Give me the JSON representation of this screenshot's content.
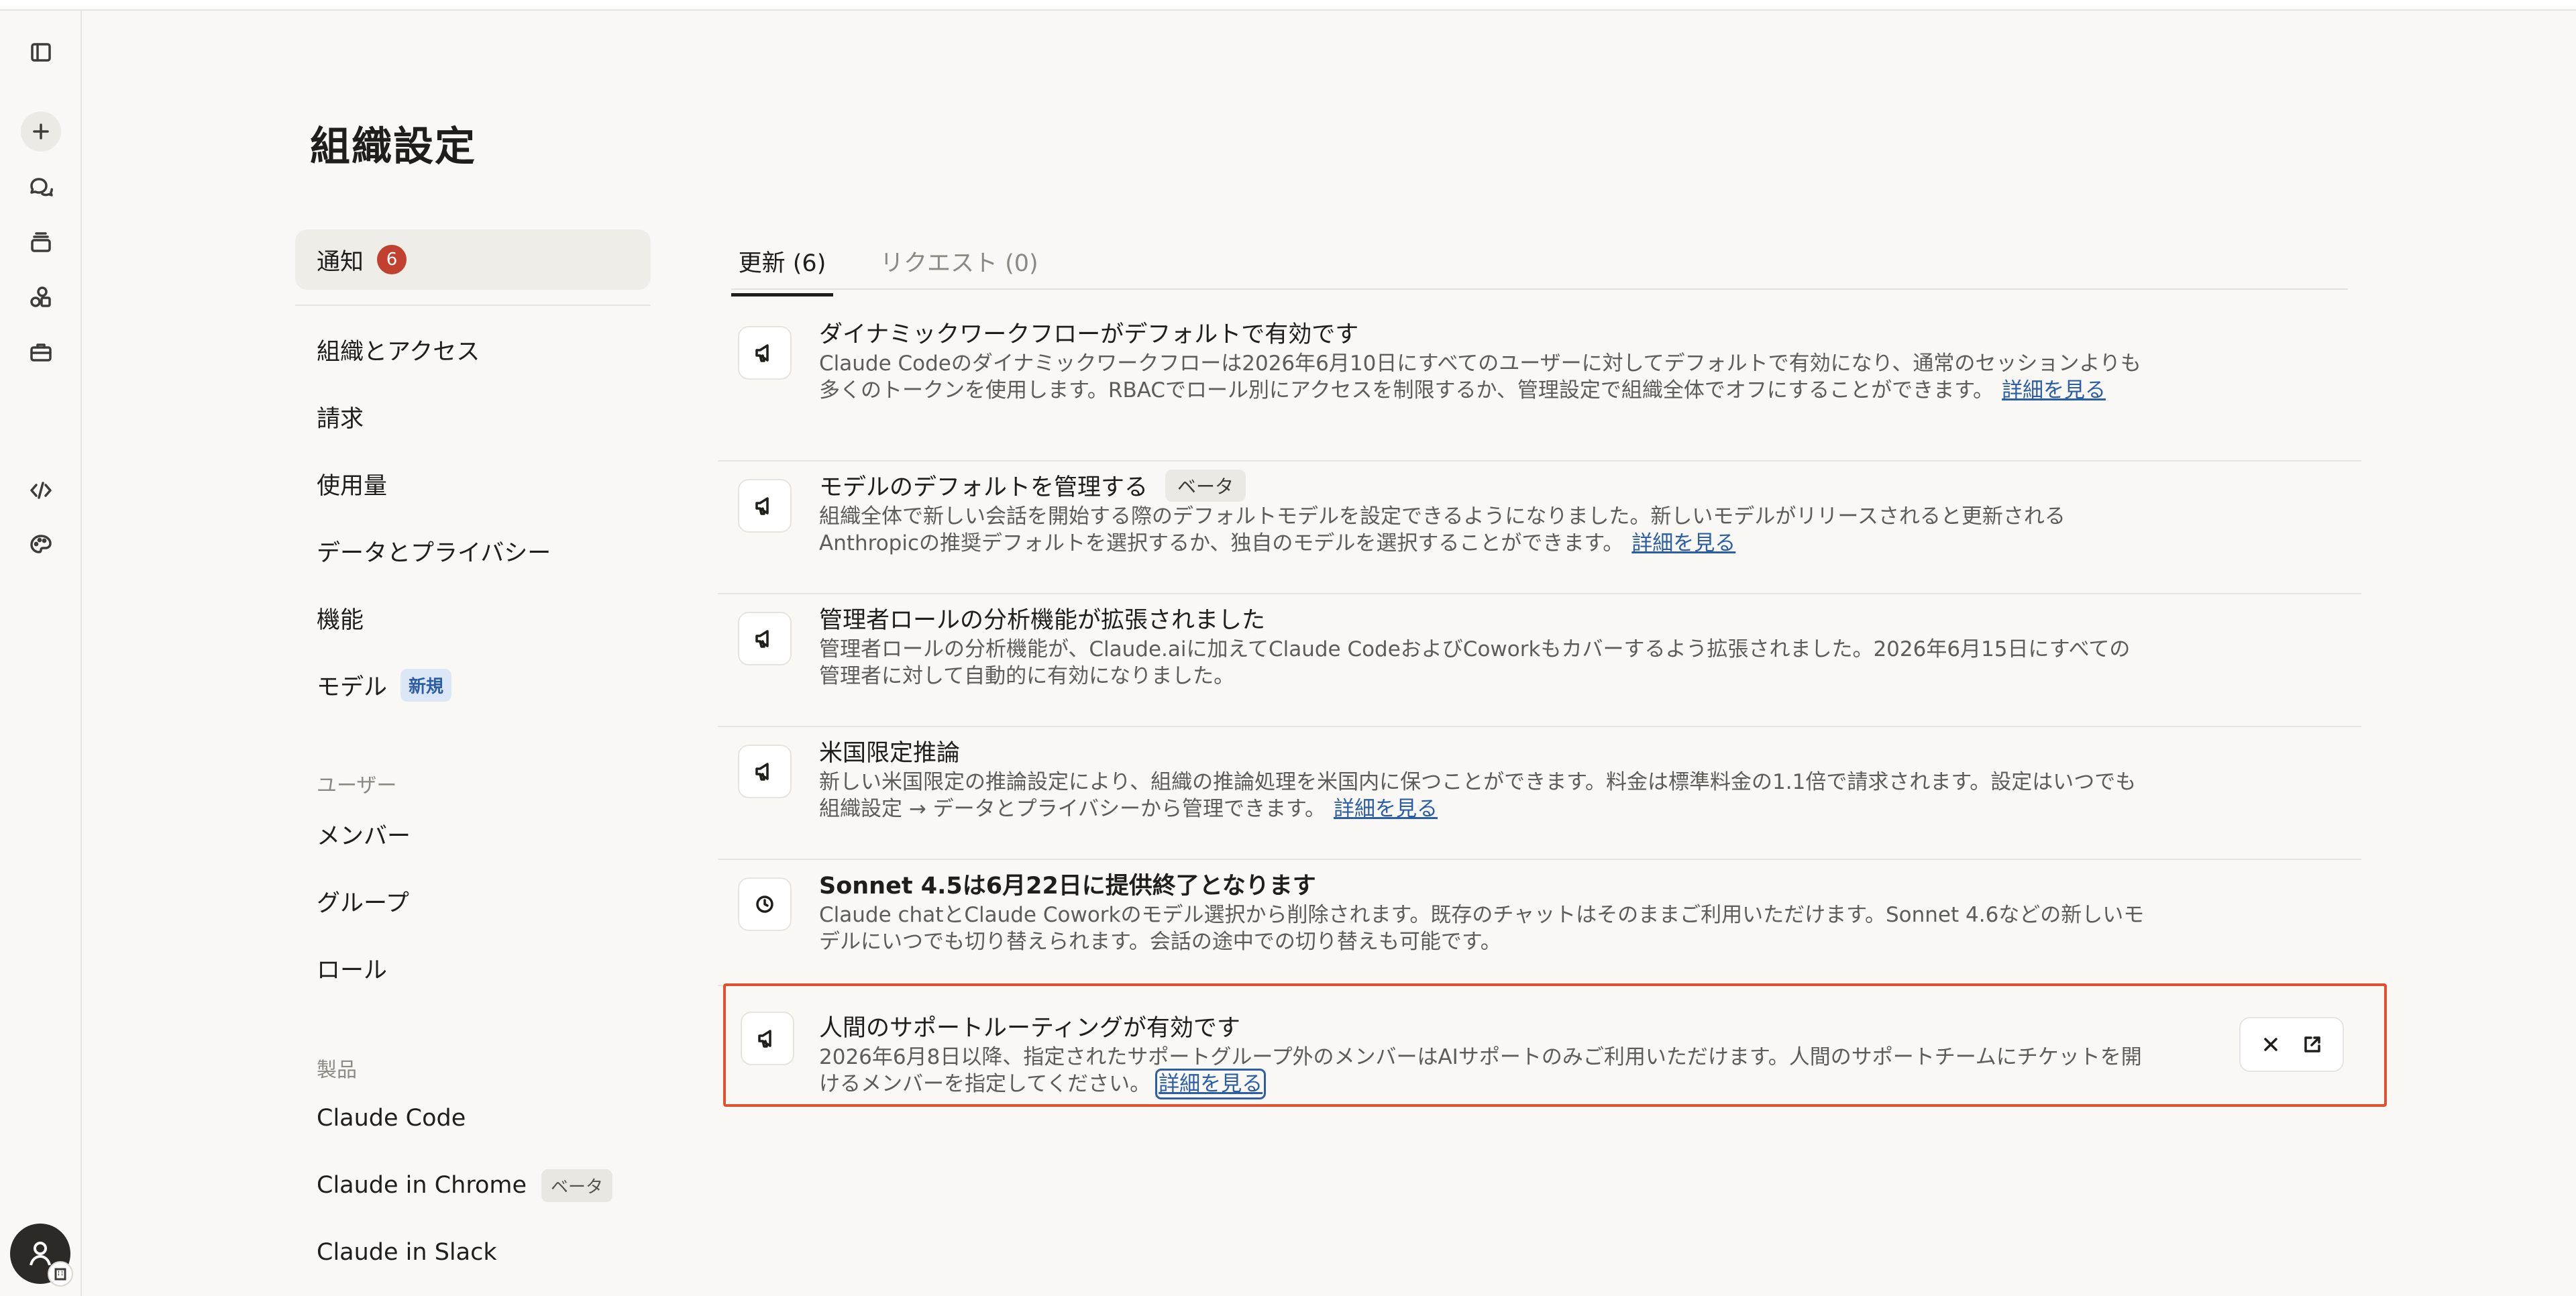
{
  "page": {
    "title": "組織設定"
  },
  "rail": {
    "icons": [
      "sidebar-toggle-icon",
      "new-chat-icon",
      "chats-icon",
      "projects-icon",
      "artifacts-icon",
      "tools-icon",
      "code-icon",
      "palette-icon"
    ]
  },
  "nav": {
    "notifications": {
      "label": "通知",
      "count": "6"
    },
    "items": [
      {
        "label": "組織とアクセス"
      },
      {
        "label": "請求"
      },
      {
        "label": "使用量"
      },
      {
        "label": "データとプライバシー"
      },
      {
        "label": "機能"
      },
      {
        "label": "モデル",
        "badge": "新規"
      }
    ],
    "users_section": "ユーザー",
    "user_items": [
      {
        "label": "メンバー"
      },
      {
        "label": "グループ"
      },
      {
        "label": "ロール"
      }
    ],
    "products_section": "製品",
    "product_items": [
      {
        "label": "Claude Code"
      },
      {
        "label": "Claude in Chrome",
        "badge": "ベータ"
      },
      {
        "label": "Claude in Slack"
      }
    ]
  },
  "tabs": [
    {
      "label": "更新 (6)",
      "active": true
    },
    {
      "label": "リクエスト (0)",
      "active": false
    }
  ],
  "notifications": [
    {
      "icon": "megaphone-icon",
      "title": "ダイナミックワークフローがデフォルトで有効です",
      "body": "Claude Codeのダイナミックワークフローは2026年6月10日にすべてのユーザーに対してデフォルトで有効になり、通常のセッションよりも多くのトークンを使用します。RBACでロール別にアクセスを制限するか、管理設定で組織全体でオフにすることができます。",
      "link": "詳細を見る"
    },
    {
      "icon": "megaphone-icon",
      "title": "モデルのデフォルトを管理する",
      "badge": "ベータ",
      "body": "組織全体で新しい会話を開始する際のデフォルトモデルを設定できるようになりました。新しいモデルがリリースされると更新されるAnthropicの推奨デフォルトを選択するか、独自のモデルを選択することができます。",
      "link": "詳細を見る"
    },
    {
      "icon": "megaphone-icon",
      "title": "管理者ロールの分析機能が拡張されました",
      "body": "管理者ロールの分析機能が、Claude.aiに加えてClaude CodeおよびCoworkもカバーするよう拡張されました。2026年6月15日にすべての管理者に対して自動的に有効になりました。",
      "link": ""
    },
    {
      "icon": "megaphone-icon",
      "title": "米国限定推論",
      "body": "新しい米国限定の推論設定により、組織の推論処理を米国内に保つことができます。料金は標準料金の1.1倍で請求されます。設定はいつでも組織設定 → データとプライバシーから管理できます。",
      "link": "詳細を見る"
    },
    {
      "icon": "clock-icon",
      "title": "Sonnet 4.5は6月22日に提供終了となります",
      "body": "Claude chatとClaude Coworkのモデル選択から削除されます。既存のチャットはそのままご利用いただけます。Sonnet 4.6などの新しいモデルにいつでも切り替えられます。会話の途中での切り替えも可能です。",
      "link": ""
    },
    {
      "icon": "megaphone-icon",
      "title": "人間のサポートルーティングが有効です",
      "body": "2026年6月8日以降、指定されたサポートグループ外のメンバーはAIサポートのみご利用いただけます。人間のサポートチームにチケットを開けるメンバーを指定してください。",
      "link": "詳細を見る",
      "highlighted": true
    }
  ],
  "colors": {
    "accent_link": "#2b5ea7",
    "badge_red": "#c0412f",
    "highlight_border": "#e0512f"
  }
}
